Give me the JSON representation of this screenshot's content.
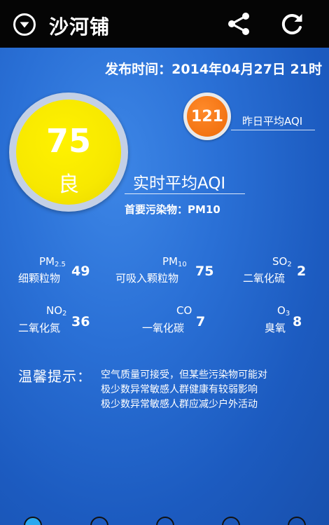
{
  "header": {
    "location": "沙河铺",
    "location_icon": "chevron-down-circle-icon",
    "share_icon": "share-icon",
    "refresh_icon": "refresh-icon"
  },
  "publish_time": "发布时间：2014年04月27日  21时",
  "yesterday": {
    "value": "121",
    "label": "昨日平均AQI",
    "color": "#ee6a08"
  },
  "aqi": {
    "value": "75",
    "level": "良",
    "title": "实时平均AQI",
    "primary_pollutant": "首要污染物：PM10",
    "color": "#f7e800"
  },
  "pollutants": [
    {
      "name": "PM",
      "sub": "2.5",
      "desc": "细颗粒物",
      "value": "49"
    },
    {
      "name": "PM",
      "sub": "10",
      "desc": "可吸入颗粒物",
      "value": "75"
    },
    {
      "name": "SO",
      "sub": "2",
      "desc": "二氧化硫",
      "value": "2"
    },
    {
      "name": "NO",
      "sub": "2",
      "desc": "二氧化氮",
      "value": "36"
    },
    {
      "name": "CO",
      "sub": "",
      "desc": "一氧化碳",
      "value": "7"
    },
    {
      "name": "O",
      "sub": "3",
      "desc": "臭氧",
      "value": "8"
    }
  ],
  "tips": {
    "title": "温馨提示：",
    "lines": [
      "空气质量可接受，但某些污染物可能对",
      "极少数异常敏感人群健康有较弱影响",
      "极少数异常敏感人群应减少户外活动"
    ]
  },
  "colors": {
    "background": "#1e5fc4",
    "topbar": "#050505"
  }
}
